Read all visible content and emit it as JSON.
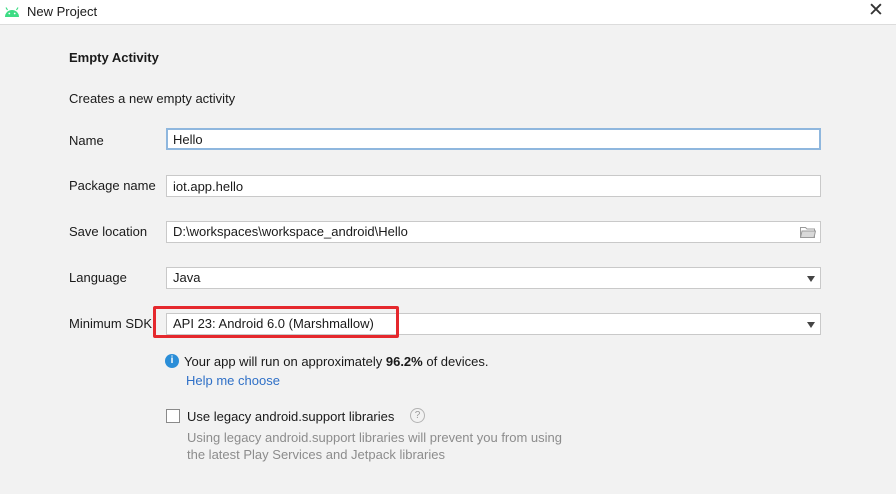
{
  "window": {
    "title": "New Project",
    "close_glyph": "✕"
  },
  "template": {
    "title": "Empty Activity",
    "description": "Creates a new empty activity"
  },
  "form": {
    "name": {
      "label": "Name",
      "value": "Hello"
    },
    "package": {
      "label": "Package name",
      "value": "iot.app.hello"
    },
    "save_location": {
      "label": "Save location",
      "value": "D:\\workspaces\\workspace_android\\Hello"
    },
    "language": {
      "label": "Language",
      "value": "Java"
    },
    "min_sdk": {
      "label": "Minimum SDK",
      "value": "API 23: Android 6.0 (Marshmallow)"
    }
  },
  "info": {
    "icon_glyph": "i",
    "text_before": "Your app will run on approximately ",
    "percentage": "96.2%",
    "text_after": " of devices.",
    "help_link": "Help me choose"
  },
  "legacy": {
    "label": "Use legacy android.support libraries",
    "help_glyph": "?",
    "checked": false,
    "hint_line1": "Using legacy android.support libraries will prevent you from using",
    "hint_line2": "the latest Play Services and Jetpack libraries"
  },
  "colors": {
    "highlight_border": "#e5282d",
    "link": "#2f70c7",
    "info_icon": "#2b8ed8",
    "android_green": "#3ddc84"
  },
  "icons": [
    "android-icon",
    "close-icon",
    "folder-icon",
    "dropdown-arrow-icon",
    "info-icon",
    "help-icon"
  ]
}
